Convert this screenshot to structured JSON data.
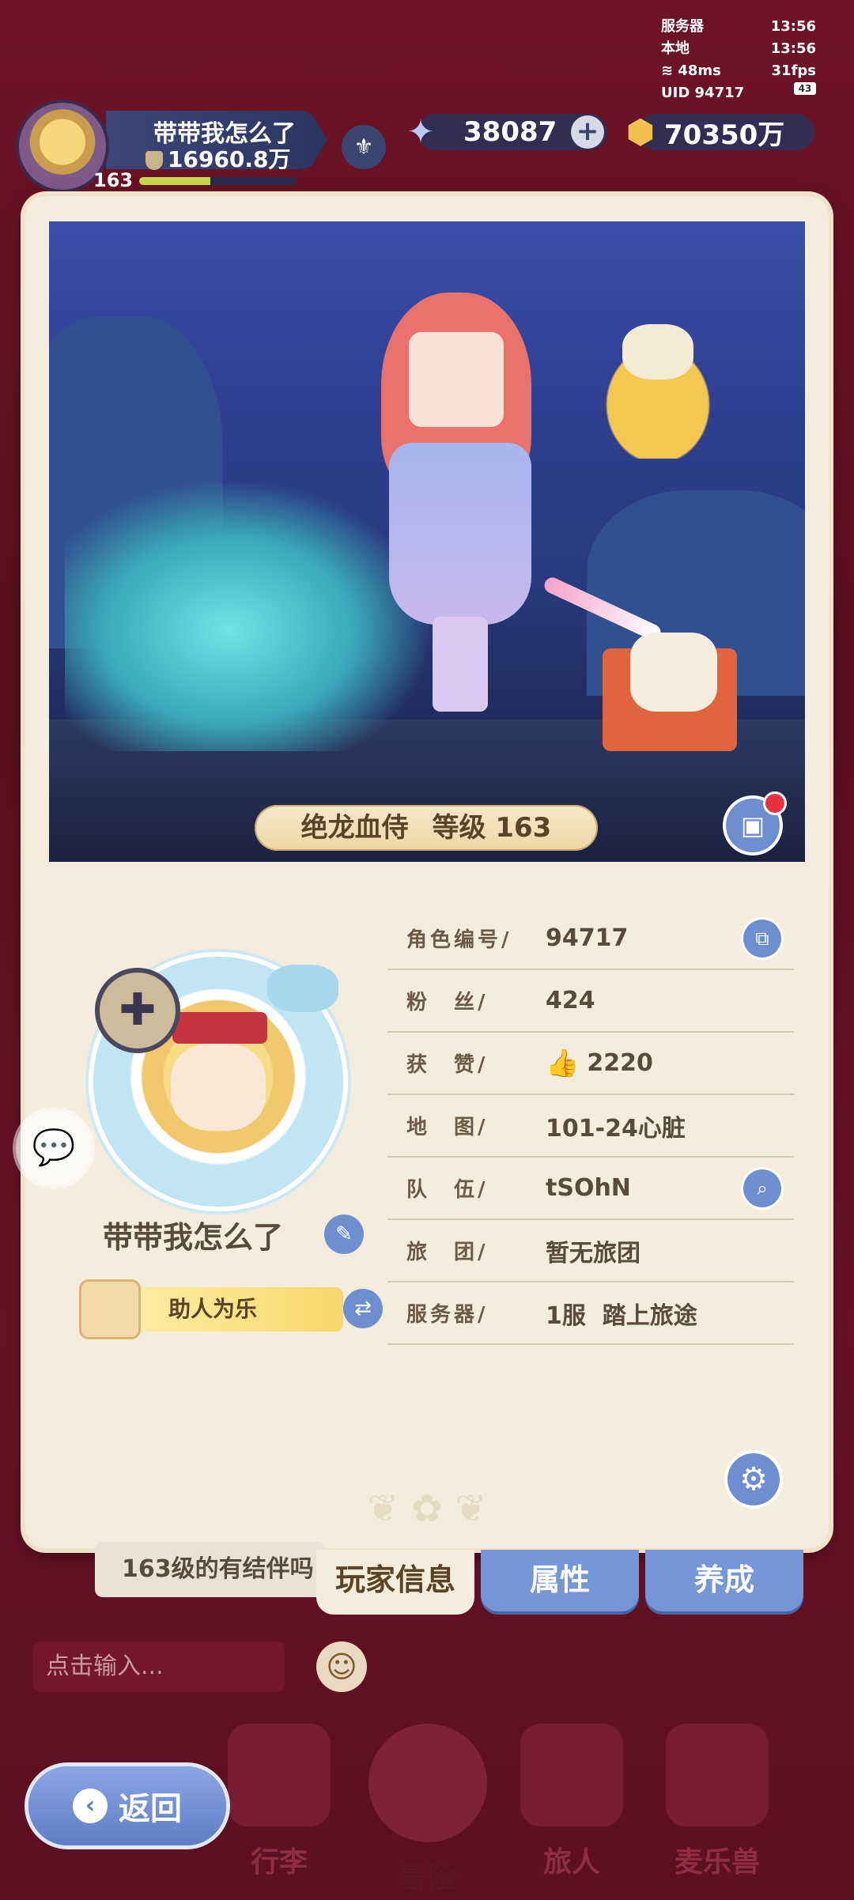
{
  "hud": {
    "server_label": "服务器",
    "server_time": "13:56",
    "local_label": "本地",
    "local_time": "13:56",
    "ping": "48ms",
    "fps": "31fps",
    "uid": "UID 94717",
    "battery": "43"
  },
  "player_chip": {
    "name": "带带我怎么了",
    "power": "16960.8万",
    "level": "163",
    "level_progress": 0.45
  },
  "currency": {
    "stars": "38087",
    "gold": "70350万",
    "star_icon": "star-crystal-icon",
    "gold_icon": "gold-coin-icon"
  },
  "scene": {
    "title": "绝龙血侍",
    "level_label": "等级",
    "level": "163"
  },
  "profile": {
    "nickname": "带带我怎么了",
    "title_tag": "助人为乐"
  },
  "info": [
    {
      "key": "角色编号/",
      "value": "94717",
      "action": "copy-icon"
    },
    {
      "key": "粉　丝/",
      "value": "424"
    },
    {
      "key": "获　赞/",
      "value": "2220",
      "icon": "thumbs-up-icon"
    },
    {
      "key": "地　图/",
      "value": "101-24心脏"
    },
    {
      "key": "队　伍/",
      "value": "tSOhN",
      "action": "search-icon"
    },
    {
      "key": "旅　团/",
      "value": "暂无旅团"
    },
    {
      "key": "服务器/",
      "value": "1服  踏上旅途"
    }
  ],
  "tabs": [
    {
      "label": "玩家信息",
      "active": true
    },
    {
      "label": "属性",
      "active": false
    },
    {
      "label": "养成",
      "active": false
    }
  ],
  "background": {
    "chat_message": "163级的有结伴吗",
    "chat_placeholder": "点击输入..."
  },
  "nav": [
    {
      "label": "行李"
    },
    {
      "label": "冒险"
    },
    {
      "label": "旅人"
    },
    {
      "label": "麦乐兽"
    }
  ],
  "back_label": "返回",
  "colors": {
    "accent_blue": "#6d8fd0",
    "card_bg": "#f4ecdc",
    "bg_red": "#6e1325",
    "badge_red": "#e8323a"
  }
}
